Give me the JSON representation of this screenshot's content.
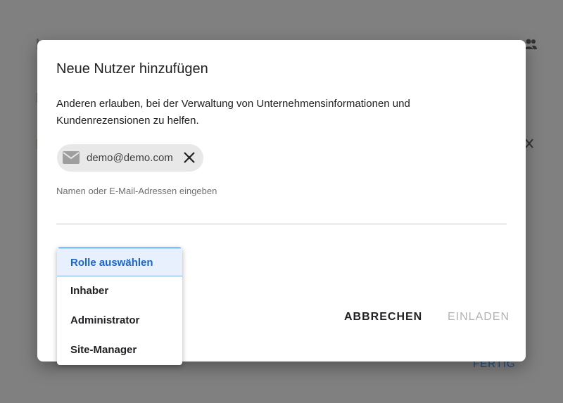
{
  "background": {
    "done_label": "FERTIG"
  },
  "dialog": {
    "title": "Neue Nutzer hinzufügen",
    "description": "Anderen erlauben, bei der Verwaltung von Unternehmensinformationen und Kundenrezensionen zu helfen.",
    "chip": {
      "icon": "mail-icon",
      "email": "demo@demo.com",
      "remove_icon": "close-icon"
    },
    "input": {
      "placeholder": "Namen oder E-Mail-Adressen eingeben"
    },
    "role_menu": {
      "selected": "Rolle auswählen",
      "options": [
        "Rolle auswählen",
        "Inhaber",
        "Administrator",
        "Site-Manager"
      ]
    },
    "buttons": {
      "cancel": "ABBRECHEN",
      "invite": "EINLADEN"
    }
  },
  "colors": {
    "overlay": "#808080",
    "accent": "#1967d2",
    "selected_bg": "#e8f0fe",
    "disabled_text": "#b0b4b8"
  }
}
